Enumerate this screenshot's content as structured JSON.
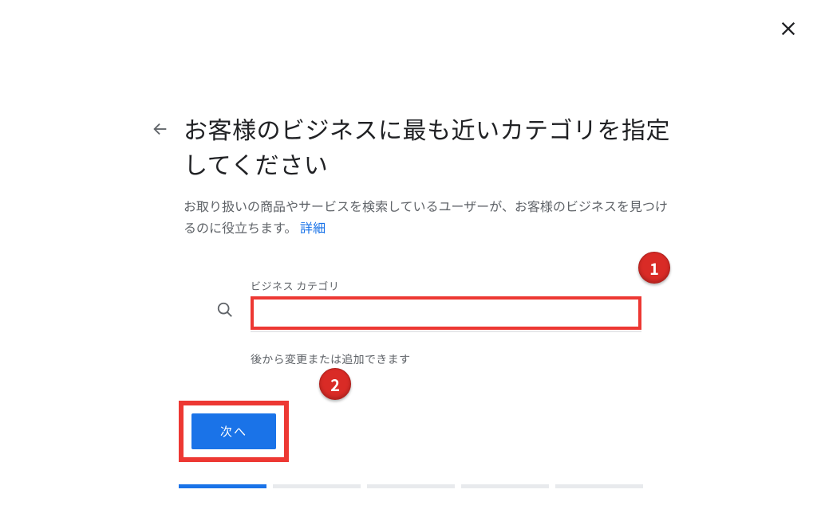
{
  "title": "お客様のビジネスに最も近いカテゴリを指定してください",
  "description_pre": "お取り扱いの商品やサービスを検索しているユーザーが、お客様のビジネスを見つけるのに役立ちます。",
  "description_link": "詳細",
  "field_label": "ビジネス カテゴリ",
  "input_value": "",
  "helper_text": "後から変更または追加できます",
  "next_button": "次へ",
  "callouts": {
    "one": "1",
    "two": "2"
  },
  "progress": {
    "total": 5,
    "current": 1
  }
}
